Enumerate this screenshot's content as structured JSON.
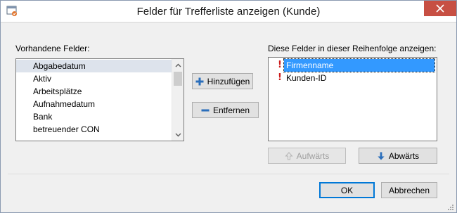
{
  "window": {
    "title": "Felder für Trefferliste anzeigen (Kunde)"
  },
  "available": {
    "label": "Vorhandene Felder:",
    "items": [
      "Abgabedatum",
      "Aktiv",
      "Arbeitsplätze",
      "Aufnahmedatum",
      "Bank",
      "betreuender CON"
    ]
  },
  "actions": {
    "add_label": "Hinzufügen",
    "remove_label": "Entfernen"
  },
  "shown": {
    "label": "Diese Felder in dieser Reihenfolge anzeigen:",
    "items": [
      "Firmenname",
      "Kunden-ID"
    ]
  },
  "order": {
    "up_label": "Aufwärts",
    "down_label": "Abwärts"
  },
  "footer": {
    "ok_label": "OK",
    "cancel_label": "Abbrechen"
  },
  "colors": {
    "add_icon": "#2a6ebb",
    "remove_icon": "#2a6ebb",
    "down_arrow": "#2a6ebb",
    "exclamation": "#cc1b1b",
    "close_button": "#c74f43",
    "selection": "#3399ff"
  }
}
